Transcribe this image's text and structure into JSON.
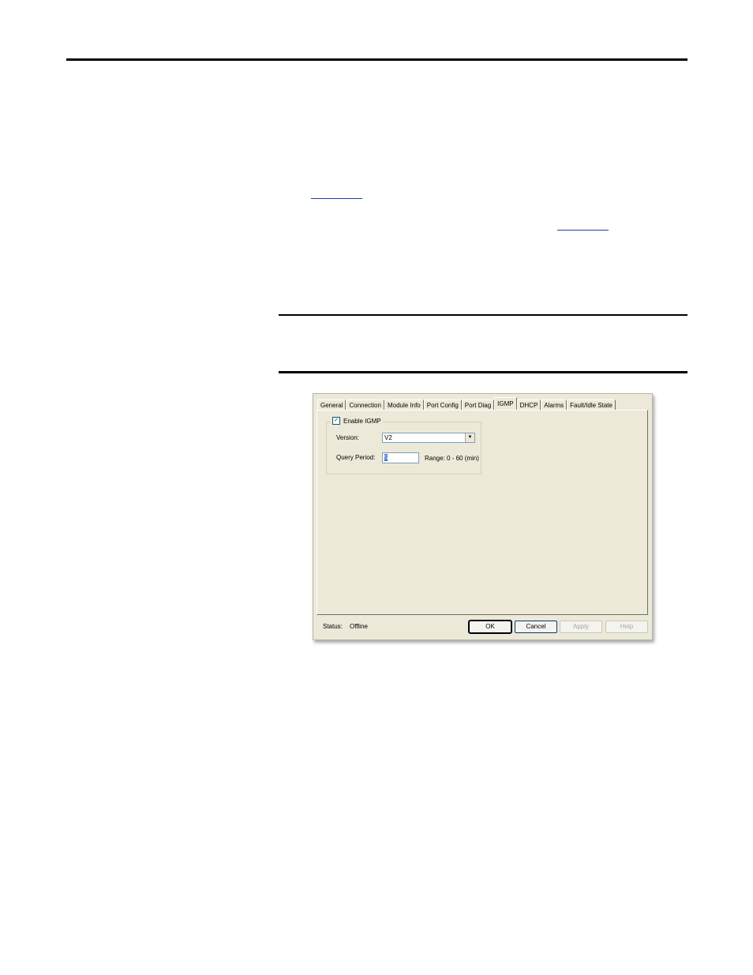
{
  "dialog": {
    "tabs": [
      "General",
      "Connection",
      "Module Info",
      "Port Config",
      "Port Diag",
      "IGMP",
      "DHCP",
      "Alarms",
      "Fault/Idle State"
    ],
    "active_tab": "IGMP",
    "group": {
      "enable_label": "Enable IGMP",
      "enable_checked": true,
      "version_label": "Version:",
      "version_value": "V2",
      "query_label": "Query Period:",
      "query_value": "5",
      "range_text": "Range: 0 - 60 (min)"
    },
    "status_label": "Status:",
    "status_value": "Offline",
    "buttons": {
      "ok": "OK",
      "cancel": "Cancel",
      "apply": "Apply",
      "help": "Help"
    }
  },
  "icons": {
    "checkmark": "checkmark-icon",
    "dropdown": "chevron-down-icon"
  }
}
